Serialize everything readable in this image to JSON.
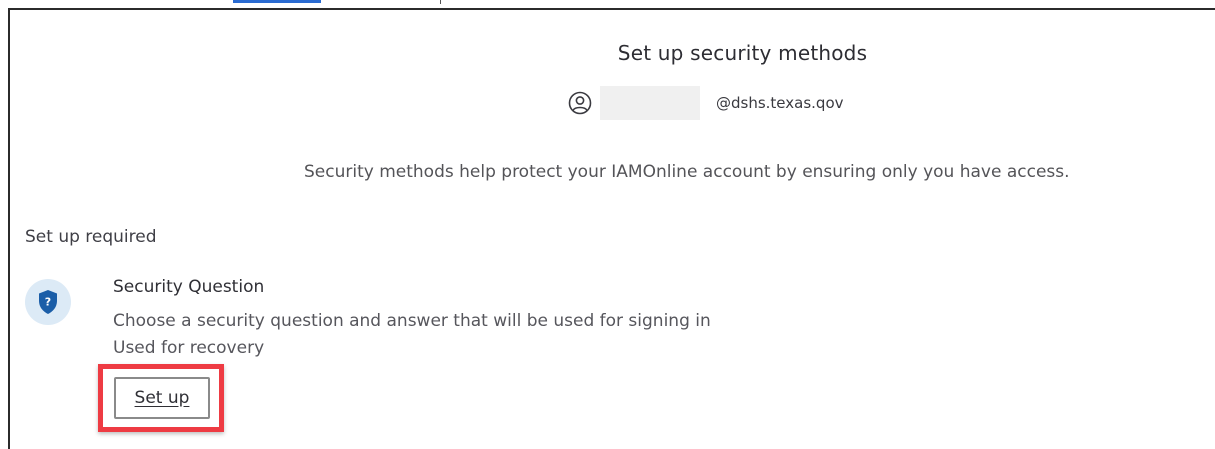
{
  "header": {
    "title": "Set up security methods"
  },
  "identity": {
    "icon": "user-circle-icon",
    "email_suffix": "@dshs.texas.qov"
  },
  "intro": {
    "description": "Security methods help protect your IAMOnline account by ensuring only you have access."
  },
  "required_section": {
    "heading": "Set up required",
    "methods": [
      {
        "icon": "security-question-shield-icon",
        "icon_glyph": "?",
        "title": "Security Question",
        "description": "Choose a security question and answer that will be used for signing in",
        "usage": "Used for recovery",
        "button_label": "Set up"
      }
    ]
  },
  "colors": {
    "shield": "#1b5ea8",
    "icon_bg": "#dceaf6",
    "highlight": "#ee3b43"
  }
}
